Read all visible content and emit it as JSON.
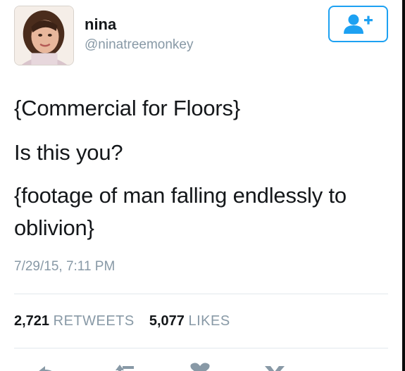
{
  "user": {
    "display_name": "nina",
    "handle": "@ninatreemonkey",
    "avatar": "avatar-photo"
  },
  "follow_button": {
    "icon": "add-user-icon",
    "color": "#1da1f2"
  },
  "tweet": {
    "lines": [
      "{Commercial for Floors}",
      "Is this you?",
      "{footage of man falling endlessly to",
      "oblivion}"
    ],
    "timestamp": "7/29/15, 7:11 PM"
  },
  "stats": {
    "retweets_count": "2,721",
    "retweets_label": "RETWEETS",
    "likes_count": "5,077",
    "likes_label": "LIKES"
  },
  "actions": [
    "reply-icon",
    "retweet-icon",
    "like-icon",
    "more-icon"
  ],
  "colors": {
    "text": "#14171a",
    "muted": "#8899a6",
    "accent": "#1da1f2",
    "divider": "#e1e8ed"
  }
}
